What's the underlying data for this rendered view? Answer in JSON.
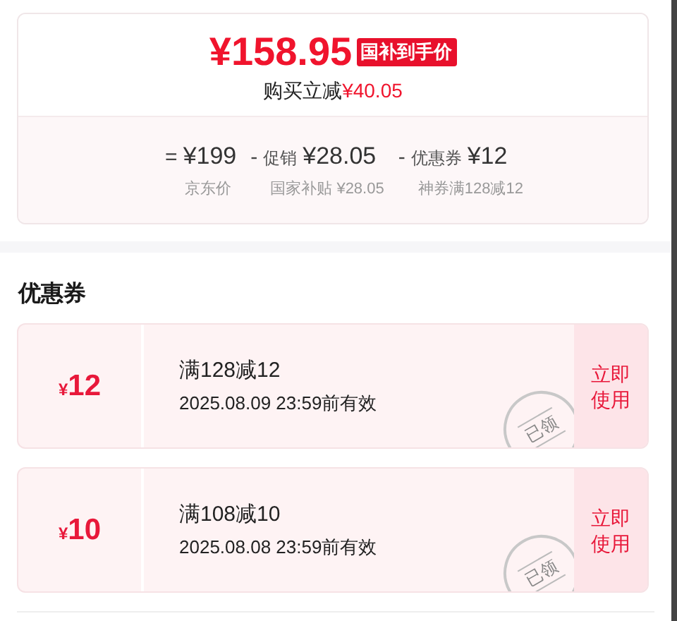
{
  "price_card": {
    "price": "¥158.95",
    "badge": "国补到手价",
    "saving_label": "购买立减",
    "saving_amount": "¥40.05",
    "breakdown": [
      {
        "op": "=",
        "amount": "¥199",
        "caption": "京东价"
      },
      {
        "op": "-",
        "label": "促销",
        "amount": "¥28.05",
        "caption": "国家补贴 ¥28.05"
      },
      {
        "op": "-",
        "label": "优惠券",
        "amount": "¥12",
        "caption": "神券满128减12"
      }
    ]
  },
  "coupons_title": "优惠券",
  "coupons": [
    {
      "currency": "¥",
      "value": "12",
      "condition": "满128减12",
      "validity": "2025.08.09 23:59前有效",
      "stamp": "已领",
      "action": "立即使用"
    },
    {
      "currency": "¥",
      "value": "10",
      "condition": "满108减10",
      "validity": "2025.08.08 23:59前有效",
      "stamp": "已领",
      "action": "立即使用"
    }
  ]
}
